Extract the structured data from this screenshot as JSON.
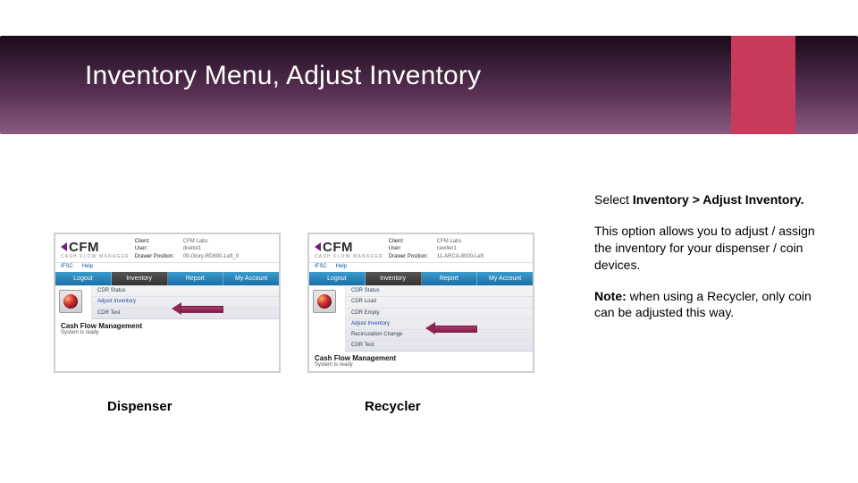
{
  "slide": {
    "title": "Inventory Menu, Adjust Inventory"
  },
  "captions": {
    "dispenser": "Dispenser",
    "recycler": "Recycler"
  },
  "side": {
    "line1_a": "Select ",
    "line1_b": "Inventory > Adjust Inventory.",
    "line2": "This option allows you to adjust / assign the inventory for your dispenser / coin devices.",
    "line3_a": "Note:",
    "line3_b": " when using a Recycler, only coin can be adjusted this way."
  },
  "shot_common": {
    "logo_text": "CFM",
    "logo_sub": "CASH FLOW MANAGER",
    "client_lbl": "Client:",
    "user_lbl": "User:",
    "drawer_lbl": "Drawer Position:",
    "nav": [
      "Logout",
      "Inventory",
      "Report",
      "My Account"
    ],
    "link_ifsc": "IFSC",
    "link_help": "Help",
    "title1": "Cash Flow Management",
    "title2": "System is ready"
  },
  "dispenser": {
    "client_val": "CFM Labs",
    "user_val": "disktst1",
    "drawer_val": "09-Glory-RD600-Left_0",
    "menu": [
      "CDR Status",
      "Adjust Inventory",
      "CDR Test"
    ]
  },
  "recycler": {
    "client_val": "CFM Labs",
    "user_val": "ceviller1",
    "drawer_val": "11-ARCA-8000-Left",
    "menu": [
      "CDR Status",
      "CDR Load",
      "CDR Empty",
      "Adjust Inventory",
      "Recirculation Change",
      "CDR Test"
    ]
  }
}
